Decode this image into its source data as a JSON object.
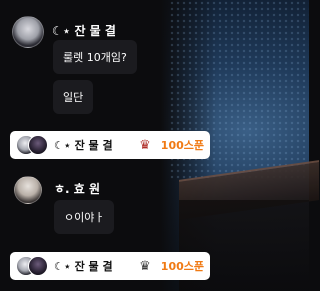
{
  "messages": [
    {
      "user": "☾⋆ 잔 물 결",
      "bubbles": [
        "룰렛 10개임?",
        "일단"
      ]
    },
    {
      "user": "ㅎ. 효 원",
      "bubbles": [
        "ㅇ이야ㅏ"
      ]
    }
  ],
  "donations": [
    {
      "user": "☾⋆ 잔 물 결",
      "crown_icon": "crown-icon",
      "crown_color": "#b1302a",
      "amount": "100스푼"
    },
    {
      "user": "☾⋆ 잔 물 결",
      "crown_icon": "crown-icon",
      "crown_color": "#3a3a3a",
      "amount": "100스푼"
    }
  ],
  "colors": {
    "amount": "#f07a14",
    "bubble_bg": "#1b1b1f",
    "background": "#0c0c0e"
  }
}
